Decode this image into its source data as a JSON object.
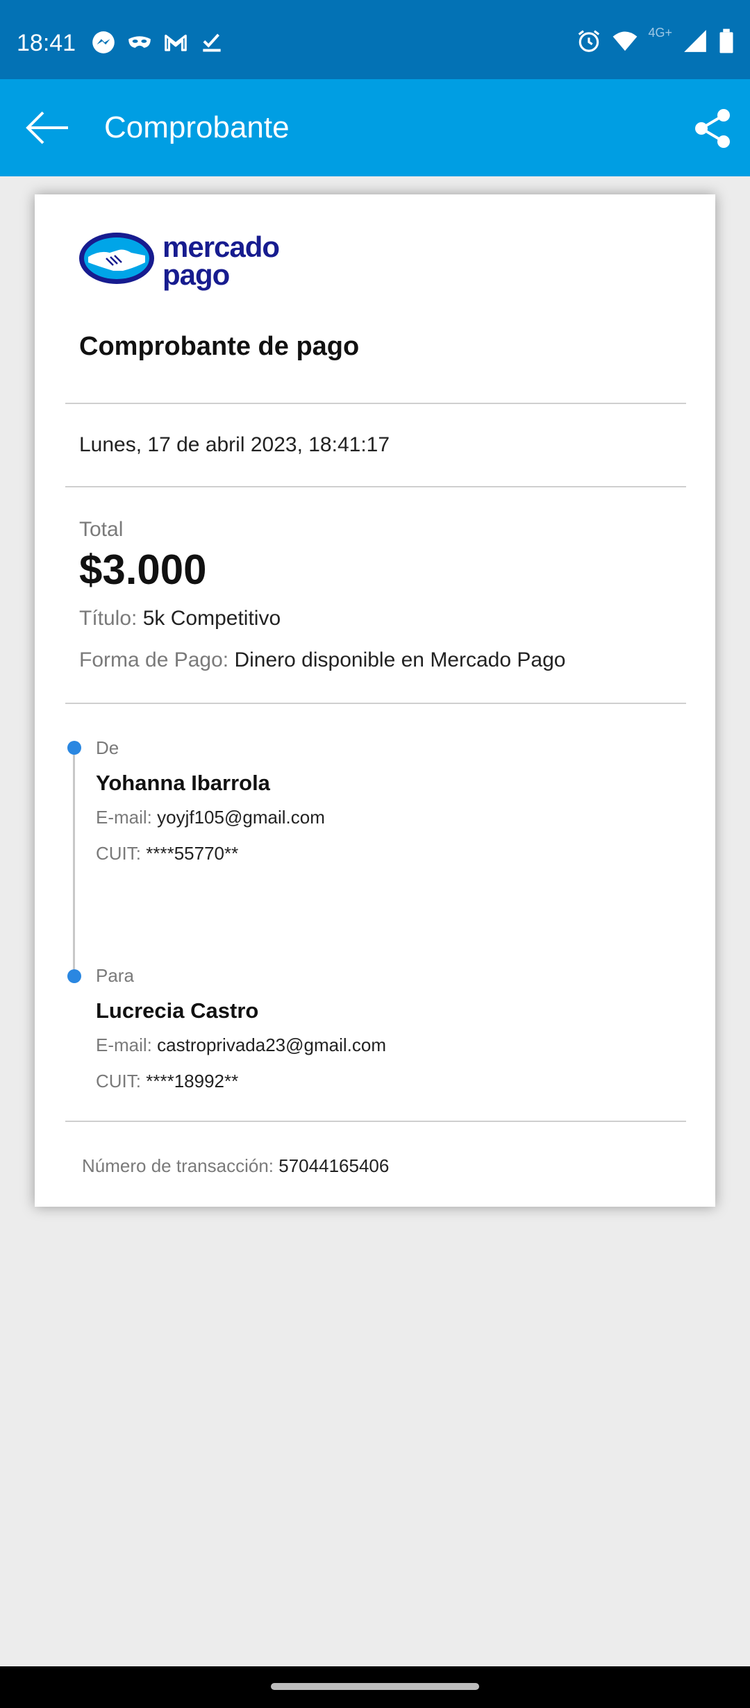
{
  "status_bar": {
    "time": "18:41",
    "left_icons": [
      "messenger-icon",
      "mask-icon",
      "gmail-icon",
      "check-icon"
    ],
    "network_label": "4G+",
    "right_icons": [
      "alarm-icon",
      "wifi-icon",
      "signal-icon",
      "battery-icon"
    ]
  },
  "app_bar": {
    "title": "Comprobante",
    "back_icon": "arrow-back-icon",
    "share_icon": "share-icon",
    "background": "#009ee3"
  },
  "receipt": {
    "logo_text_line1": "mercado",
    "logo_text_line2": "pago",
    "heading": "Comprobante de pago",
    "date": "Lunes, 17 de abril 2023, 18:41:17",
    "total_label": "Total",
    "total_amount": "$3.000",
    "title_label": "Título:",
    "title_value": "5k Competitivo",
    "payment_label": "Forma de Pago:",
    "payment_value": "Dinero disponible en Mercado Pago",
    "from": {
      "label": "De",
      "name": "Yohanna Ibarrola",
      "email_label": "E-mail:",
      "email": "yoyjf105@gmail.com",
      "cuit_label": "CUIT:",
      "cuit": "****55770**"
    },
    "to": {
      "label": "Para",
      "name": "Lucrecia Castro",
      "email_label": "E-mail:",
      "email": "castroprivada23@gmail.com",
      "cuit_label": "CUIT:",
      "cuit": "****18992**"
    },
    "transaction_label": "Número de transacción:",
    "transaction_number": "57044165406"
  },
  "colors": {
    "status_bar": "#0372b5",
    "accent_blue": "#009ee3",
    "timeline_dot": "#2a87e1",
    "logo_navy": "#171c8f"
  }
}
